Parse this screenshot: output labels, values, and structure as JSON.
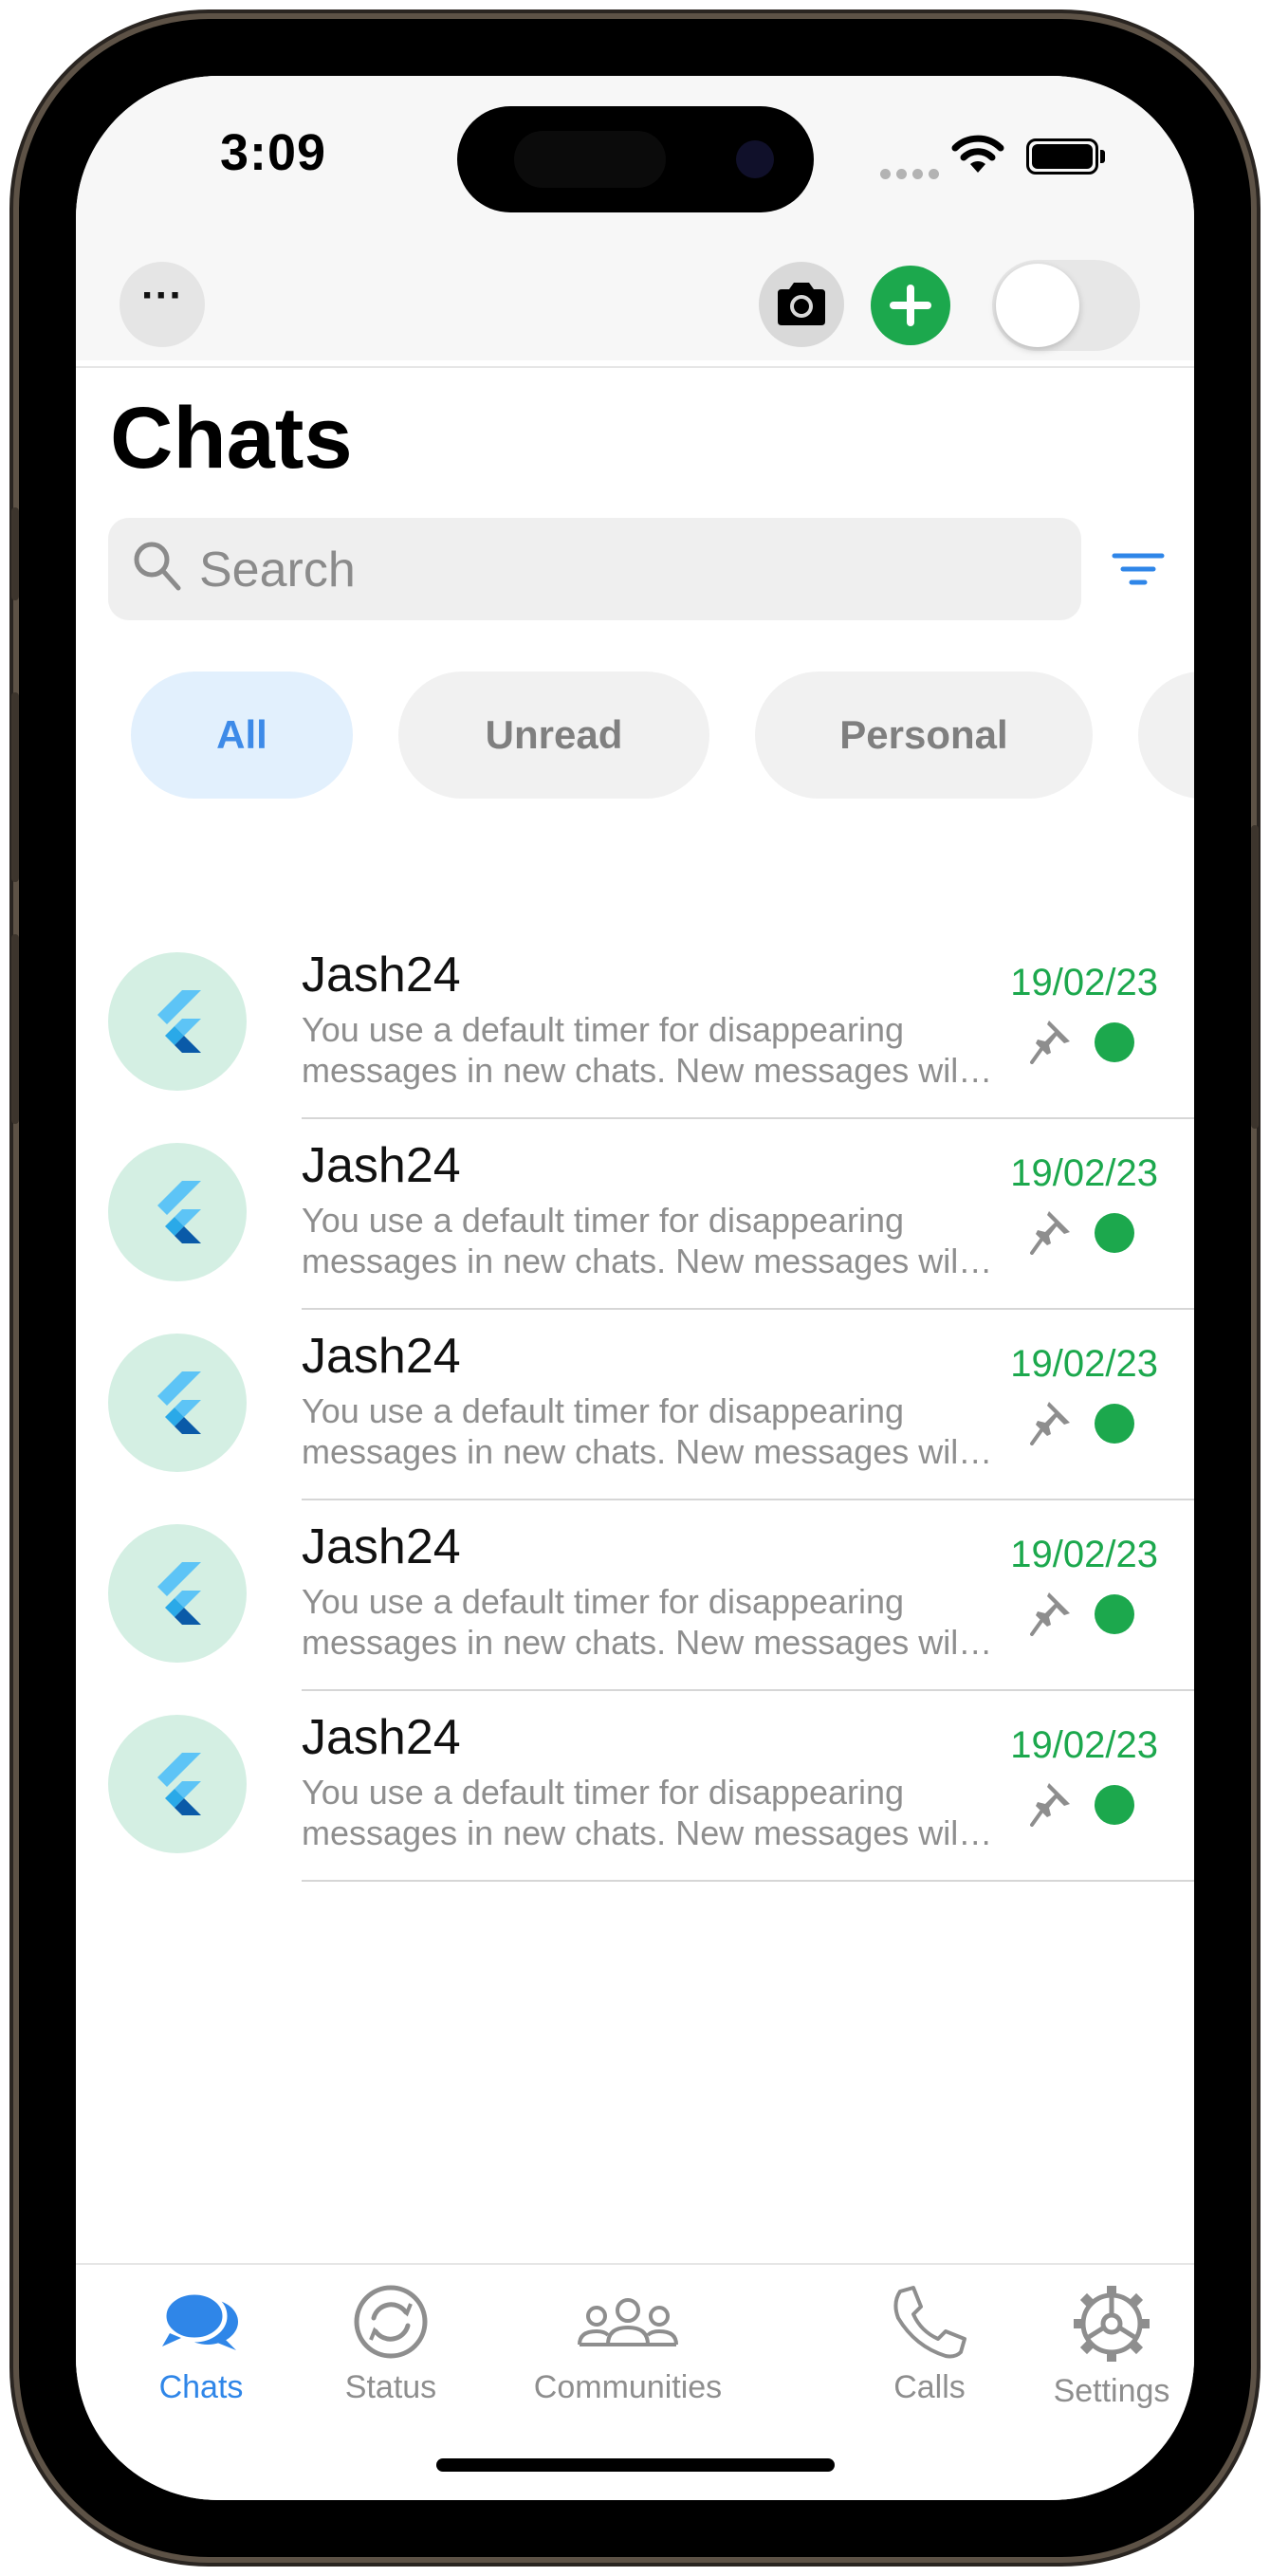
{
  "status_bar": {
    "time": "3:09"
  },
  "toolbar": {
    "more_icon": "ellipsis-icon",
    "camera_icon": "camera-icon",
    "add_icon": "plus-icon",
    "toggle_on": false
  },
  "header": {
    "title": "Chats"
  },
  "search": {
    "placeholder": "Search",
    "value": ""
  },
  "filters": [
    {
      "label": "All",
      "active": true
    },
    {
      "label": "Unread",
      "active": false
    },
    {
      "label": "Personal",
      "active": false
    }
  ],
  "chats": [
    {
      "name": "Jash24",
      "message": "You use a default timer for disappearing messages in new chats. New messages will disappear from this chat after the duration you set.",
      "date": "19/02/23",
      "pinned": true,
      "unread": true
    },
    {
      "name": "Jash24",
      "message": "You use a default timer for disappearing messages in new chats. New messages will disappear from this chat after the duration you set.",
      "date": "19/02/23",
      "pinned": true,
      "unread": true
    },
    {
      "name": "Jash24",
      "message": "You use a default timer for disappearing messages in new chats. New messages will disappear from this chat after the duration you set.",
      "date": "19/02/23",
      "pinned": true,
      "unread": true
    },
    {
      "name": "Jash24",
      "message": "You use a default timer for disappearing messages in new chats. New messages will disappear from this chat after the duration you set.",
      "date": "19/02/23",
      "pinned": true,
      "unread": true
    },
    {
      "name": "Jash24",
      "message": "You use a default timer for disappearing messages in new chats. New messages will disappear from this chat after the duration you set.",
      "date": "19/02/23",
      "pinned": true,
      "unread": true
    }
  ],
  "tabs": [
    {
      "label": "Chats",
      "icon": "chat-bubbles-icon",
      "active": true
    },
    {
      "label": "Status",
      "icon": "status-icon",
      "active": false
    },
    {
      "label": "Communities",
      "icon": "communities-icon",
      "active": false
    },
    {
      "label": "Calls",
      "icon": "phone-icon",
      "active": false
    },
    {
      "label": "Settings",
      "icon": "gear-icon",
      "active": false
    }
  ],
  "colors": {
    "accent_green": "#1ca84d",
    "accent_blue": "#2f86e8",
    "avatar_bg": "#d4efe3",
    "chip_active_bg": "#e2f0fd"
  }
}
